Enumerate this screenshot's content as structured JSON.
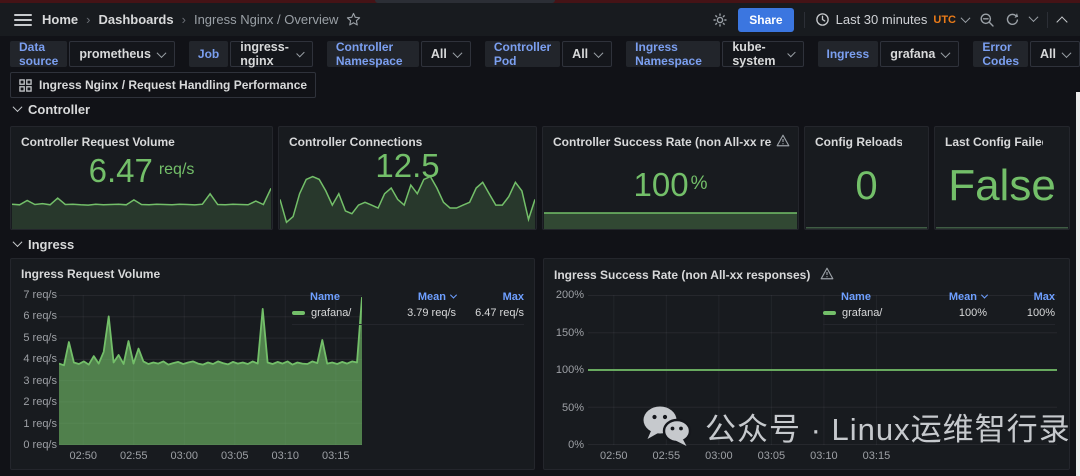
{
  "colors": {
    "green": "#73bf69",
    "legend_blue": "#6e9fff",
    "filter_label_blue": "#7b9ff0",
    "share_blue": "#3b76e0",
    "utc_orange": "#eb7b18",
    "panel_bg": "#181b1f",
    "page_bg": "#111217",
    "watermark_gray": "#c6c9cd"
  },
  "nav": {
    "breadcrumb": [
      "Home",
      "Dashboards",
      "Ingress Nginx / Overview"
    ],
    "share": "Share",
    "time_range": "Last 30 minutes",
    "timezone": "UTC"
  },
  "filters": [
    {
      "label": "Data source",
      "value": "prometheus"
    },
    {
      "label": "Job",
      "value": "ingress-nginx"
    },
    {
      "label": "Controller Namespace",
      "value": "All"
    },
    {
      "label": "Controller Pod",
      "value": "All"
    },
    {
      "label": "Ingress Namespace",
      "value": "kube-system"
    },
    {
      "label": "Ingress",
      "value": "grafana"
    },
    {
      "label": "Error Codes",
      "value": "All"
    }
  ],
  "perf_link": {
    "label": "Ingress Nginx / Request Handling Performance"
  },
  "sections": {
    "controller": "Controller",
    "ingress": "Ingress"
  },
  "stats": [
    {
      "title": "Controller Request Volume",
      "value": "6.47",
      "unit": "req/s"
    },
    {
      "title": "Controller Connections",
      "value": "12.5",
      "unit": ""
    },
    {
      "title": "Controller Success Rate (non All-xx respons",
      "value": "100",
      "unit": "%"
    },
    {
      "title": "Config Reloads",
      "value": "0",
      "unit": ""
    },
    {
      "title": "Last Config Failed",
      "value": "False",
      "unit": ""
    }
  ],
  "sparklines": {
    "request_volume": {
      "ymin": 0,
      "ymax": 7.2,
      "fill_opacity": 0.18,
      "values": [
        3.9,
        3.8,
        4.5,
        3.85,
        4.0,
        3.8,
        4.9,
        3.85,
        3.9,
        3.8,
        3.75,
        3.9,
        3.8,
        3.85,
        3.9,
        3.8,
        4.6,
        3.85,
        3.8,
        3.9,
        3.85,
        3.8,
        3.9,
        3.85,
        3.78,
        3.9,
        5.6,
        3.85,
        3.8,
        3.9,
        3.85,
        3.8,
        4.4,
        3.85,
        6.5
      ]
    },
    "connections": {
      "ymin": 4,
      "ymax": 14.5,
      "fill_opacity": 0.18,
      "values": [
        9,
        5,
        6,
        10,
        12.5,
        13,
        12.5,
        10.5,
        8,
        10,
        7,
        6.5,
        8,
        8.5,
        8,
        7.5,
        10,
        11,
        9,
        8,
        11.5,
        10,
        12.5,
        13,
        11,
        8.5,
        7.5,
        7.5,
        8,
        8.5,
        11,
        12,
        10,
        8,
        8,
        9.5,
        12,
        10.5,
        5.5,
        9
      ]
    },
    "success_band": {
      "ymin": 0,
      "ymax": 100,
      "fill_opacity": 0.28,
      "values": [
        100,
        100
      ]
    },
    "flat_zero": {
      "ymin": 0,
      "ymax": 1,
      "fill_opacity": 0,
      "color": "#3f5c44",
      "values": [
        0.05,
        0.05
      ]
    }
  },
  "chart_data": [
    {
      "type": "area",
      "title": "Ingress Request Volume",
      "xlabel": "",
      "ylabel": "req/s",
      "ylim": [
        0,
        7
      ],
      "yticks": [
        "7 req/s",
        "6 req/s",
        "5 req/s",
        "4 req/s",
        "3 req/s",
        "2 req/s",
        "1 req/s",
        "0 req/s"
      ],
      "xticks": [
        "02:50",
        "02:55",
        "03:00",
        "03:05",
        "03:10",
        "03:15"
      ],
      "xtick_start_frac": 0.08,
      "xtick_step_frac": 0.1667,
      "grid": true,
      "legend": {
        "position": "right",
        "headers": [
          "Name",
          "Mean",
          "Max"
        ],
        "sort": "Mean"
      },
      "series": [
        {
          "name": "grafana/",
          "mean": "3.79 req/s",
          "max": "6.47 req/s",
          "color": "#73bf69",
          "fill_opacity": 0.62,
          "values": [
            3.8,
            3.72,
            4.8,
            3.85,
            3.78,
            3.9,
            3.75,
            4.15,
            3.8,
            4.35,
            6.0,
            3.85,
            4.2,
            3.78,
            4.85,
            3.8,
            4.5,
            3.9,
            3.78,
            3.85,
            3.8,
            3.9,
            3.75,
            3.82,
            3.88,
            3.78,
            3.85,
            3.9,
            3.8,
            3.75,
            3.85,
            3.78,
            3.9,
            3.82,
            3.76,
            3.88,
            3.8,
            3.85,
            3.78,
            3.9,
            3.8,
            6.35,
            3.85,
            3.78,
            3.88,
            3.8,
            3.9,
            3.75,
            3.85,
            3.8,
            3.78,
            3.9,
            3.82,
            4.9,
            3.8,
            3.85,
            3.78,
            3.88,
            3.8,
            3.9,
            3.85,
            6.9
          ]
        }
      ]
    },
    {
      "type": "line",
      "title": "Ingress Success Rate (non All-xx responses)",
      "xlabel": "",
      "ylabel": "%",
      "ylim": [
        0,
        200
      ],
      "yticks": [
        "200%",
        "150%",
        "100%",
        "50%",
        "0%"
      ],
      "xticks": [
        "02:50",
        "02:55",
        "03:00",
        "03:05",
        "03:10",
        "03:15"
      ],
      "xtick_start_frac": 0.055,
      "xtick_step_frac": 0.112,
      "grid": true,
      "legend": {
        "position": "overlay-top-right",
        "headers": [
          "Name",
          "Mean",
          "Max"
        ],
        "sort": "Mean"
      },
      "series": [
        {
          "name": "grafana/",
          "mean": "100%",
          "max": "100%",
          "color": "#73bf69",
          "fill_opacity": 0,
          "values": [
            100,
            100
          ]
        }
      ]
    }
  ],
  "watermark": {
    "text": "公众号 · Linux运维智行录"
  }
}
